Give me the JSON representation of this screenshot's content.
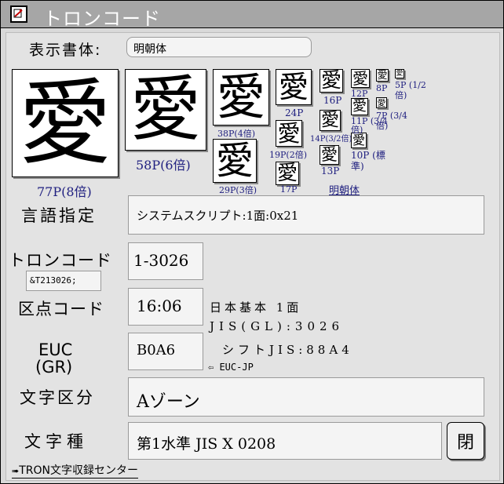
{
  "window": {
    "title": "トロンコード"
  },
  "font_row": {
    "label": "表示書体:",
    "value": "明朝体"
  },
  "glyph_char": "愛",
  "glyphs": [
    {
      "caption": "77P(8倍)"
    },
    {
      "caption": "58P(6倍)"
    },
    {
      "caption": "38P(4倍)"
    },
    {
      "caption": "29P(3倍)"
    },
    {
      "caption": "24P"
    },
    {
      "caption": "19P(2倍)"
    },
    {
      "caption": "17P"
    },
    {
      "caption": "16P"
    },
    {
      "caption": "14P(3/2倍)"
    },
    {
      "caption": "13P"
    },
    {
      "caption": "12P"
    },
    {
      "caption": "11P (3/4倍)"
    },
    {
      "caption": "10P (標準)"
    },
    {
      "caption": "8P"
    },
    {
      "caption": "7P (3/4倍)"
    },
    {
      "caption": "5P (1/2倍)"
    }
  ],
  "font_link": "明朝体",
  "language": {
    "label": "言語指定",
    "value": "システムスクリプト:1面:0x21"
  },
  "tron_code": {
    "label": "トロンコード",
    "entity": "&T213026;",
    "value": "1-3026"
  },
  "kuten": {
    "label": "区点コード",
    "value": "16:06"
  },
  "euc": {
    "label_line1": "EUC",
    "label_line2": "(GR)",
    "value": "B0A6",
    "convert": "⇦ EUC-JP"
  },
  "info": {
    "line1": "日本基本 1面",
    "line2": "JIS(GL):3026",
    "line3": "シフトJIS:88A4"
  },
  "char_class": {
    "label": "文字区分",
    "value": "Aゾーン"
  },
  "char_type": {
    "label": "文字種",
    "value": "第1水準 JIS X 0208"
  },
  "close_button": "閉",
  "footer_link": "TRON文字収録センター"
}
